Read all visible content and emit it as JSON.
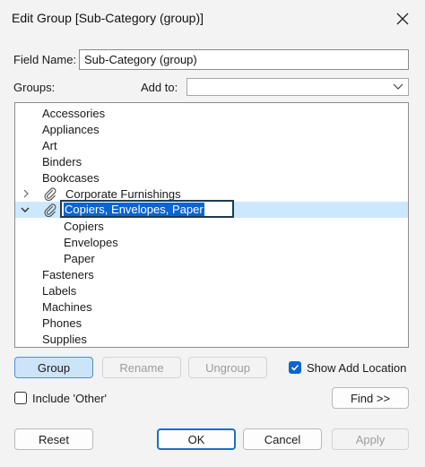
{
  "window": {
    "title": "Edit Group [Sub-Category (group)]"
  },
  "field_name": {
    "label": "Field Name:",
    "value": "Sub-Category (group)"
  },
  "groups": {
    "label": "Groups:"
  },
  "add_to": {
    "label": "Add to:",
    "value": ""
  },
  "tree": {
    "items": [
      {
        "label": "Accessories"
      },
      {
        "label": "Appliances"
      },
      {
        "label": "Art"
      },
      {
        "label": "Binders"
      },
      {
        "label": "Bookcases"
      },
      {
        "label": "Corporate Furnishings",
        "group": true,
        "expanded": false
      },
      {
        "label": "Copiers, Envelopes, Paper",
        "group": true,
        "expanded": true,
        "editing": true
      },
      {
        "label": "Copiers"
      },
      {
        "label": "Envelopes"
      },
      {
        "label": "Paper"
      },
      {
        "label": "Fasteners"
      },
      {
        "label": "Labels"
      },
      {
        "label": "Machines"
      },
      {
        "label": "Phones"
      },
      {
        "label": "Supplies"
      }
    ]
  },
  "buttons": {
    "group": "Group",
    "rename": "Rename",
    "ungroup": "Ungroup",
    "find": "Find >>",
    "reset": "Reset",
    "ok": "OK",
    "cancel": "Cancel",
    "apply": "Apply"
  },
  "options": {
    "show_add_location": {
      "label": "Show Add Location",
      "checked": true
    },
    "include_other": {
      "label": "Include 'Other'",
      "checked": false
    }
  },
  "colors": {
    "accent": "#0a64d2",
    "selection": "#cce8ff"
  }
}
